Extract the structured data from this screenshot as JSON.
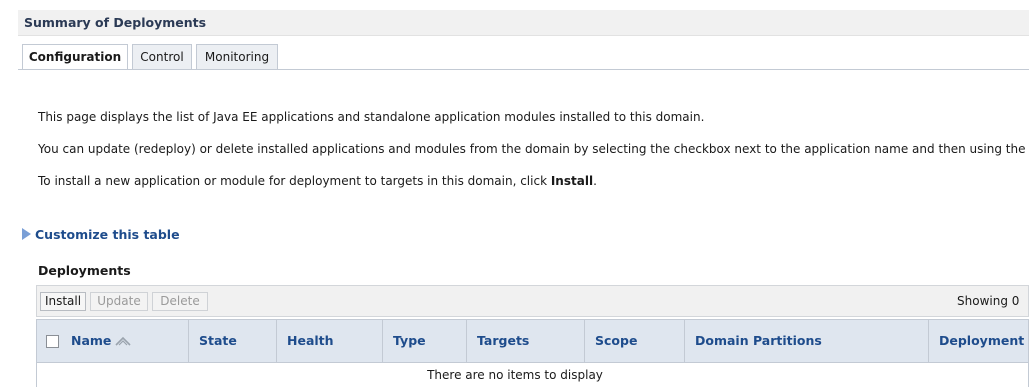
{
  "page": {
    "title": "Summary of Deployments",
    "tabs": [
      {
        "label": "Configuration",
        "active": true
      },
      {
        "label": "Control",
        "active": false
      },
      {
        "label": "Monitoring",
        "active": false
      }
    ]
  },
  "intro": {
    "line1": "This page displays the list of Java EE applications and standalone application modules installed to this domain.",
    "line2": "You can update (redeploy) or delete installed applications and modules from the domain by selecting the checkbox next to the application name and then using the cont",
    "line3_prefix": "To install a new application or module for deployment to targets in this domain, click ",
    "line3_bold": "Install",
    "line3_suffix": "."
  },
  "customize": {
    "label": "Customize this table",
    "icon": "expand-triangle-icon"
  },
  "deployments": {
    "title": "Deployments",
    "toolbar": {
      "install_label": "Install",
      "update_label": "Update",
      "delete_label": "Delete",
      "showing_text": "Showing 0"
    },
    "columns": [
      "Name",
      "State",
      "Health",
      "Type",
      "Targets",
      "Scope",
      "Domain Partitions",
      "Deployment"
    ],
    "empty_message": "There are no items to display"
  },
  "colors": {
    "link_blue": "#1e4c8c",
    "header_bg": "#dfe6ef",
    "toolbar_bg": "#f1f1f1"
  }
}
